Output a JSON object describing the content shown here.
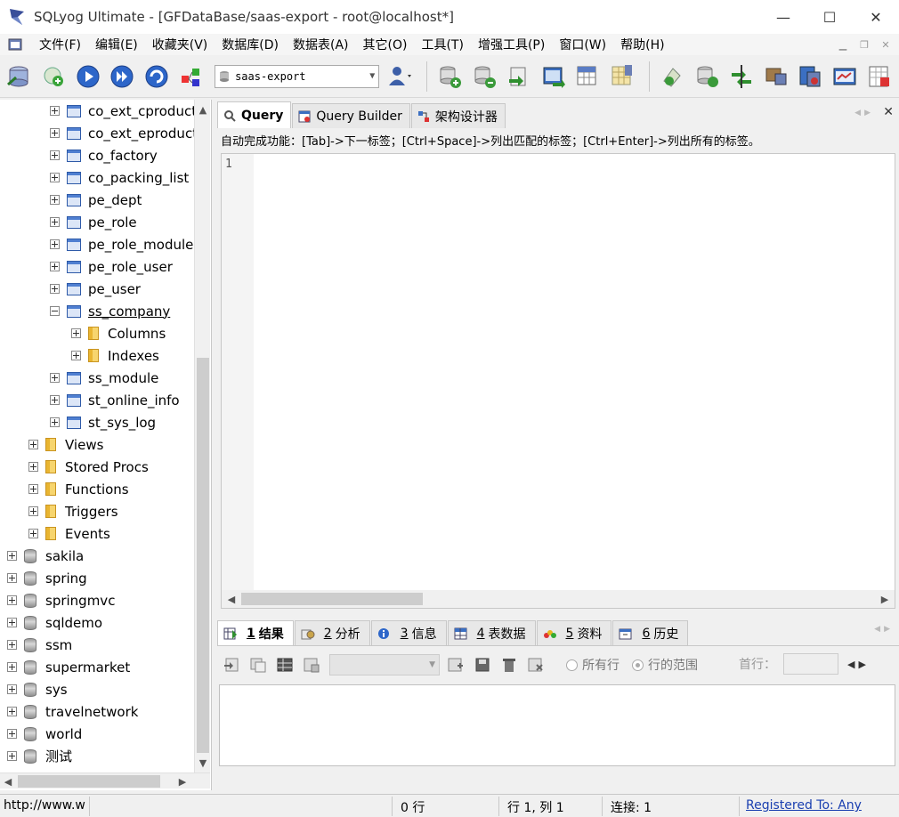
{
  "window": {
    "title": "SQLyog Ultimate - [GFDataBase/saas-export - root@localhost*]",
    "minimize": "—",
    "maximize": "☐",
    "close": "✕"
  },
  "menu": {
    "items": [
      "文件(F)",
      "编辑(E)",
      "收藏夹(V)",
      "数据库(D)",
      "数据表(A)",
      "其它(O)",
      "工具(T)",
      "增强工具(P)",
      "窗口(W)",
      "帮助(H)"
    ]
  },
  "toolbar": {
    "database_selected": "saas-export"
  },
  "tree": {
    "rows": [
      {
        "label": "co_ext_cproduct",
        "icon": "table-icon",
        "expander": "plus"
      },
      {
        "label": "co_ext_eproduct",
        "icon": "table-icon",
        "expander": "plus"
      },
      {
        "label": "co_factory",
        "icon": "table-icon",
        "expander": "plus"
      },
      {
        "label": "co_packing_list",
        "icon": "table-icon",
        "expander": "plus"
      },
      {
        "label": "pe_dept",
        "icon": "table-icon",
        "expander": "plus"
      },
      {
        "label": "pe_role",
        "icon": "table-icon",
        "expander": "plus"
      },
      {
        "label": "pe_role_module",
        "icon": "table-icon",
        "expander": "plus"
      },
      {
        "label": "pe_role_user",
        "icon": "table-icon",
        "expander": "plus"
      },
      {
        "label": "pe_user",
        "icon": "table-icon",
        "expander": "plus"
      },
      {
        "label": "ss_company",
        "icon": "table-icon",
        "expander": "minus"
      },
      {
        "label": "Columns",
        "icon": "folder-icon",
        "expander": "plus"
      },
      {
        "label": "Indexes",
        "icon": "folder-icon",
        "expander": "plus"
      },
      {
        "label": "ss_module",
        "icon": "table-icon",
        "expander": "plus"
      },
      {
        "label": "st_online_info",
        "icon": "table-icon",
        "expander": "plus"
      },
      {
        "label": "st_sys_log",
        "icon": "table-icon",
        "expander": "plus"
      },
      {
        "label": "Views",
        "icon": "folder-icon",
        "expander": "plus"
      },
      {
        "label": "Stored Procs",
        "icon": "folder-icon",
        "expander": "plus"
      },
      {
        "label": "Functions",
        "icon": "folder-icon",
        "expander": "plus"
      },
      {
        "label": "Triggers",
        "icon": "folder-icon",
        "expander": "plus"
      },
      {
        "label": "Events",
        "icon": "folder-icon",
        "expander": "plus"
      },
      {
        "label": "sakila",
        "icon": "database-icon",
        "expander": "plus"
      },
      {
        "label": "spring",
        "icon": "database-icon",
        "expander": "plus"
      },
      {
        "label": "springmvc",
        "icon": "database-icon",
        "expander": "plus"
      },
      {
        "label": "sqldemo",
        "icon": "database-icon",
        "expander": "plus"
      },
      {
        "label": "ssm",
        "icon": "database-icon",
        "expander": "plus"
      },
      {
        "label": "supermarket",
        "icon": "database-icon",
        "expander": "plus"
      },
      {
        "label": "sys",
        "icon": "database-icon",
        "expander": "plus"
      },
      {
        "label": "travelnetwork",
        "icon": "database-icon",
        "expander": "plus"
      },
      {
        "label": "world",
        "icon": "database-icon",
        "expander": "plus"
      },
      {
        "label": "测试",
        "icon": "database-icon",
        "expander": "plus"
      }
    ]
  },
  "editor": {
    "tabs": [
      "Query",
      "Query Builder",
      "架构设计器"
    ],
    "hint": "自动完成功能：[Tab]->下一标签；[Ctrl+Space]->列出匹配的标签；[Ctrl+Enter]->列出所有的标签。",
    "line_number": "1"
  },
  "results": {
    "tabs": [
      {
        "num": "1",
        "label": "结果"
      },
      {
        "num": "2",
        "label": "分析"
      },
      {
        "num": "3",
        "label": "信息"
      },
      {
        "num": "4",
        "label": "表数据"
      },
      {
        "num": "5",
        "label": "资料"
      },
      {
        "num": "6",
        "label": "历史"
      }
    ],
    "radio_all_rows": "所有行",
    "radio_row_range": "行的范围",
    "first_row_label": "首行："
  },
  "status": {
    "url": "http://www.w",
    "rows": "0 行",
    "position": "行 1, 列 1",
    "connections": "连接: 1",
    "registered": "Registered To: Any"
  },
  "colors": {
    "accent": "#2e5aa8",
    "link": "#1a3fb0"
  }
}
